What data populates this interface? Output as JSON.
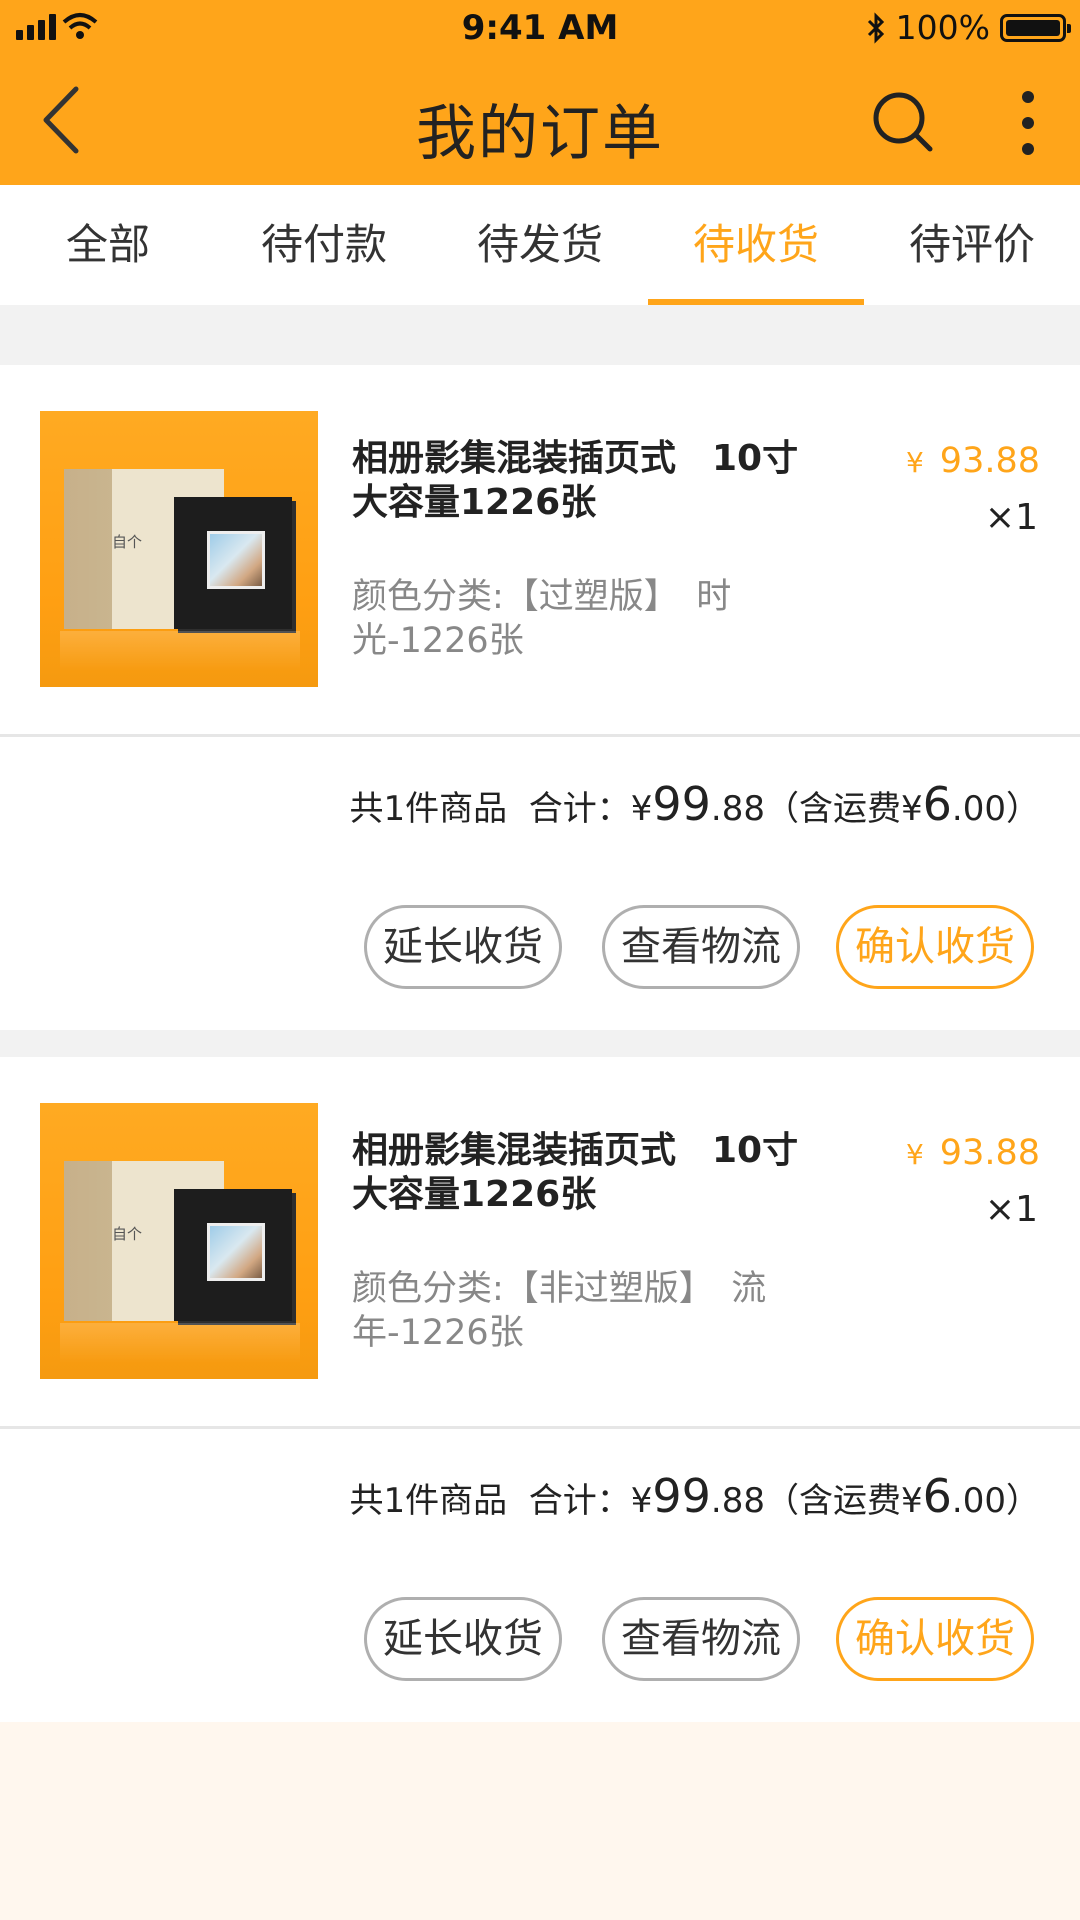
{
  "status_bar": {
    "time": "9:41 AM",
    "battery": "100%"
  },
  "header": {
    "title": "我的订单"
  },
  "tabs": [
    {
      "label": "全部",
      "active": false
    },
    {
      "label": "待付款",
      "active": false
    },
    {
      "label": "待发货",
      "active": false
    },
    {
      "label": "待收货",
      "active": true
    },
    {
      "label": "待评价",
      "active": false
    }
  ],
  "orders": [
    {
      "product_name": "相册影集混装插页式　10寸大容量1226张",
      "spec": "颜色分类:【过塑版】　时光-1226张",
      "price_symbol": "¥",
      "price": "93.88",
      "qty": "×1",
      "summary": {
        "count_text": "共1件商品",
        "total_label": "合计：",
        "total_symbol": "¥",
        "total_int": "99",
        "total_dec": ".88",
        "shipping_prefix": "（含运费",
        "shipping_symbol": "¥",
        "shipping_int": "6",
        "shipping_dec": ".00",
        "shipping_suffix": "）"
      },
      "buttons": {
        "extend": "延长收货",
        "logistics": "查看物流",
        "confirm": "确认收货"
      },
      "box_logo": "自个"
    },
    {
      "product_name": "相册影集混装插页式　10寸大容量1226张",
      "spec": "颜色分类:【非过塑版】　流年-1226张",
      "price_symbol": "¥",
      "price": "93.88",
      "qty": "×1",
      "summary": {
        "count_text": "共1件商品",
        "total_label": "合计：",
        "total_symbol": "¥",
        "total_int": "99",
        "total_dec": ".88",
        "shipping_prefix": "（含运费",
        "shipping_symbol": "¥",
        "shipping_int": "6",
        "shipping_dec": ".00",
        "shipping_suffix": "）"
      },
      "buttons": {
        "extend": "延长收货",
        "logistics": "查看物流",
        "confirm": "确认收货"
      },
      "box_logo": "自个"
    }
  ],
  "colors": {
    "accent": "#FFA51A",
    "text": "#222222",
    "muted": "#888888",
    "border": "#AFAFAF"
  },
  "icons": [
    "signal-icon",
    "wifi-icon",
    "bluetooth-icon",
    "battery-icon",
    "back-icon",
    "search-icon",
    "more-icon"
  ]
}
